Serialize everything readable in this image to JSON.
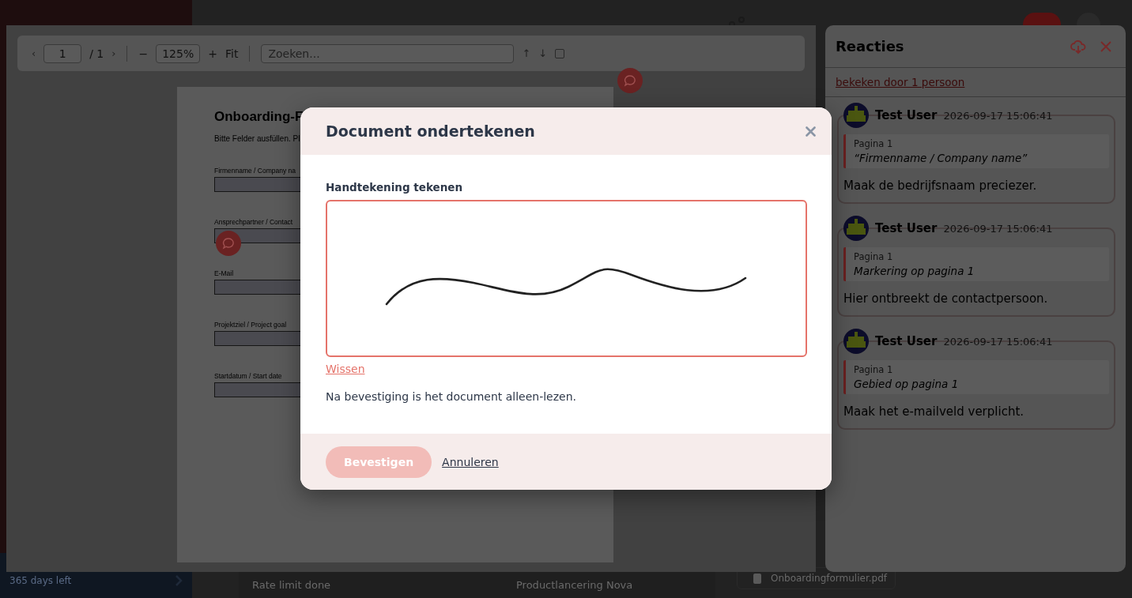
{
  "app": {
    "trial": "365 days left",
    "row": [
      "Rate limit done",
      "Productlancering Nova"
    ],
    "attachment": "Onboardingformulier.pdf"
  },
  "pdf_viewer": {
    "toolbar": {
      "prev": "‹",
      "page": "1",
      "page_total": "/ 1",
      "next": "›",
      "zoom_out": "−",
      "zoom": "125%",
      "zoom_in": "+",
      "fit": "Fit",
      "search_placeholder": "Zoeken...",
      "search_up": "↑",
      "search_down": "↓"
    },
    "page": {
      "title": "Onboarding-F",
      "intro": "Bitte Felder ausfüllen. Pl",
      "fields": [
        {
          "label": "Firmenname / Company na"
        },
        {
          "label": "Ansprechpartner / Contact"
        },
        {
          "label": "E-Mail"
        },
        {
          "label": "Projektziel / Project goal"
        },
        {
          "label": "Startdatum / Start date"
        }
      ]
    }
  },
  "comments_panel": {
    "title": "Reacties",
    "seen_by": "bekeken door 1 persoon",
    "comments": [
      {
        "author": "Test User",
        "time": "2026-09-17 15:06:41",
        "page": "Pagina 1",
        "quote": "“Firmenname / Company name”",
        "text": "Maak de bedrijfsnaam preciezer."
      },
      {
        "author": "Test User",
        "time": "2026-09-17 15:06:41",
        "page": "Pagina 1",
        "quote": "Markering op pagina 1",
        "text": "Hier ontbreekt de contactpersoon."
      },
      {
        "author": "Test User",
        "time": "2026-09-17 15:06:41",
        "page": "Pagina 1",
        "quote": "Gebied op pagina 1",
        "text": "Maak het e-mailveld verplicht."
      }
    ]
  },
  "dialog": {
    "title": "Document ondertekenen",
    "field_label": "Handtekening tekenen",
    "clear_link": "Wissen",
    "note": "Na bevestiging is het document alleen-lezen.",
    "confirm": {
      "label": "Bevestigen",
      "disabled": true
    },
    "cancel": "Annuleren"
  }
}
